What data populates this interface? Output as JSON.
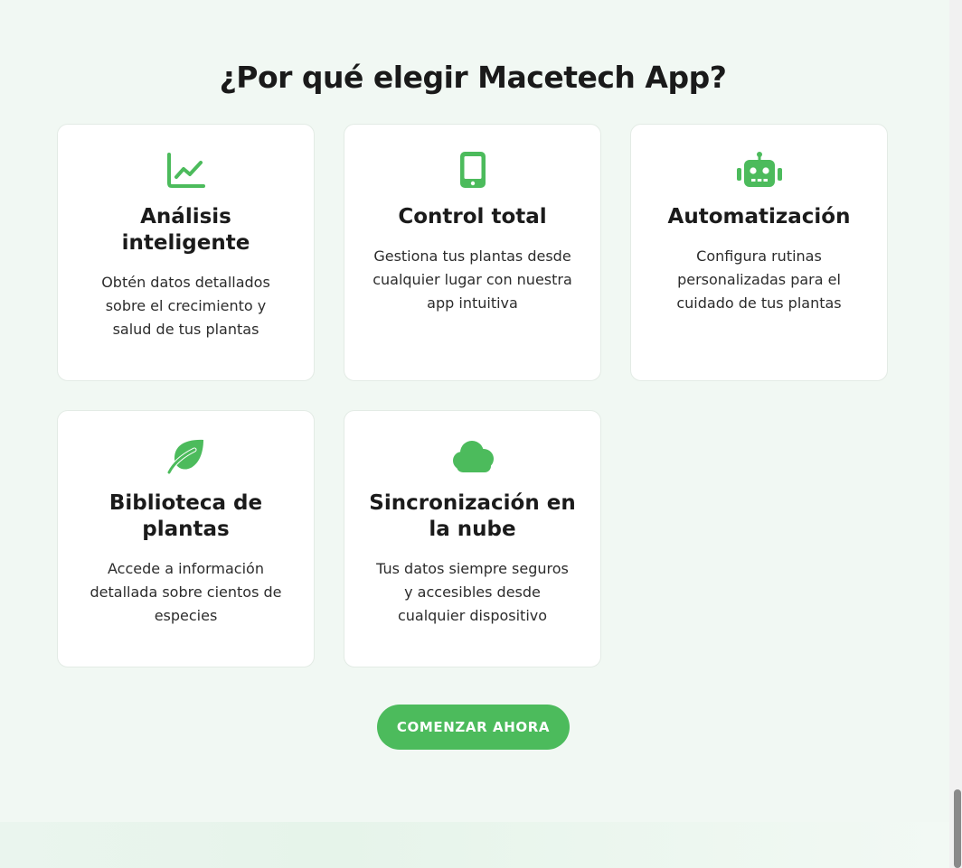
{
  "section": {
    "title": "¿Por qué elegir Macetech App?"
  },
  "features": [
    {
      "icon": "chart-line-icon",
      "title": "Análisis inteligente",
      "description": "Obtén datos detallados sobre el crecimiento y salud de tus plantas"
    },
    {
      "icon": "mobile-phone-icon",
      "title": "Control total",
      "description": "Gestiona tus plantas desde cualquier lugar con nuestra app intuitiva"
    },
    {
      "icon": "robot-icon",
      "title": "Automatización",
      "description": "Configura rutinas personalizadas para el cuidado de tus plantas"
    },
    {
      "icon": "leaf-icon",
      "title": "Biblioteca de plantas",
      "description": "Accede a información detallada sobre cientos de especies"
    },
    {
      "icon": "cloud-icon",
      "title": "Sincronización en la nube",
      "description": "Tus datos siempre seguros y accesibles desde cualquier dispositivo"
    }
  ],
  "cta": {
    "label": "COMENZAR AHORA"
  },
  "colors": {
    "accent": "#4cbb5c",
    "background": "#f1f8f3",
    "card": "#ffffff",
    "text": "#1b1b1b"
  }
}
